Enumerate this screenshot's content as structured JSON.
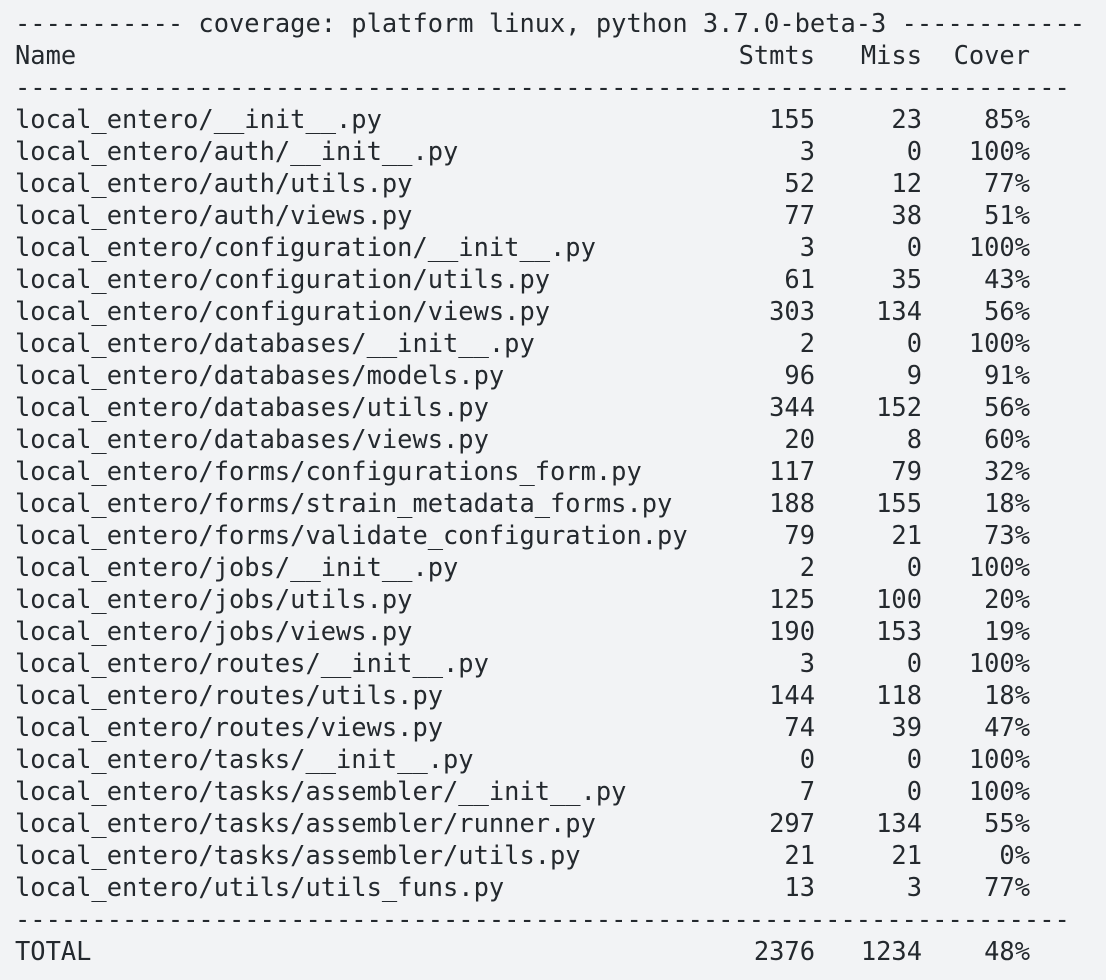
{
  "header_line": "----------- coverage: platform linux, python 3.7.0-beta-3 ------------",
  "columns": {
    "name": "Name",
    "stmts": "Stmts",
    "miss": "Miss",
    "cover": "Cover"
  },
  "separator": "---------------------------------------------------------------------",
  "rows": [
    {
      "name": "local_entero/__init__.py",
      "stmts": "155",
      "miss": "23",
      "cover": "85%"
    },
    {
      "name": "local_entero/auth/__init__.py",
      "stmts": "3",
      "miss": "0",
      "cover": "100%"
    },
    {
      "name": "local_entero/auth/utils.py",
      "stmts": "52",
      "miss": "12",
      "cover": "77%"
    },
    {
      "name": "local_entero/auth/views.py",
      "stmts": "77",
      "miss": "38",
      "cover": "51%"
    },
    {
      "name": "local_entero/configuration/__init__.py",
      "stmts": "3",
      "miss": "0",
      "cover": "100%"
    },
    {
      "name": "local_entero/configuration/utils.py",
      "stmts": "61",
      "miss": "35",
      "cover": "43%"
    },
    {
      "name": "local_entero/configuration/views.py",
      "stmts": "303",
      "miss": "134",
      "cover": "56%"
    },
    {
      "name": "local_entero/databases/__init__.py",
      "stmts": "2",
      "miss": "0",
      "cover": "100%"
    },
    {
      "name": "local_entero/databases/models.py",
      "stmts": "96",
      "miss": "9",
      "cover": "91%"
    },
    {
      "name": "local_entero/databases/utils.py",
      "stmts": "344",
      "miss": "152",
      "cover": "56%"
    },
    {
      "name": "local_entero/databases/views.py",
      "stmts": "20",
      "miss": "8",
      "cover": "60%"
    },
    {
      "name": "local_entero/forms/configurations_form.py",
      "stmts": "117",
      "miss": "79",
      "cover": "32%"
    },
    {
      "name": "local_entero/forms/strain_metadata_forms.py",
      "stmts": "188",
      "miss": "155",
      "cover": "18%"
    },
    {
      "name": "local_entero/forms/validate_configuration.py",
      "stmts": "79",
      "miss": "21",
      "cover": "73%"
    },
    {
      "name": "local_entero/jobs/__init__.py",
      "stmts": "2",
      "miss": "0",
      "cover": "100%"
    },
    {
      "name": "local_entero/jobs/utils.py",
      "stmts": "125",
      "miss": "100",
      "cover": "20%"
    },
    {
      "name": "local_entero/jobs/views.py",
      "stmts": "190",
      "miss": "153",
      "cover": "19%"
    },
    {
      "name": "local_entero/routes/__init__.py",
      "stmts": "3",
      "miss": "0",
      "cover": "100%"
    },
    {
      "name": "local_entero/routes/utils.py",
      "stmts": "144",
      "miss": "118",
      "cover": "18%"
    },
    {
      "name": "local_entero/routes/views.py",
      "stmts": "74",
      "miss": "39",
      "cover": "47%"
    },
    {
      "name": "local_entero/tasks/__init__.py",
      "stmts": "0",
      "miss": "0",
      "cover": "100%"
    },
    {
      "name": "local_entero/tasks/assembler/__init__.py",
      "stmts": "7",
      "miss": "0",
      "cover": "100%"
    },
    {
      "name": "local_entero/tasks/assembler/runner.py",
      "stmts": "297",
      "miss": "134",
      "cover": "55%"
    },
    {
      "name": "local_entero/tasks/assembler/utils.py",
      "stmts": "21",
      "miss": "21",
      "cover": "0%"
    },
    {
      "name": "local_entero/utils/utils_funs.py",
      "stmts": "13",
      "miss": "3",
      "cover": "77%"
    }
  ],
  "total": {
    "name": "TOTAL",
    "stmts": "2376",
    "miss": "1234",
    "cover": "48%"
  }
}
